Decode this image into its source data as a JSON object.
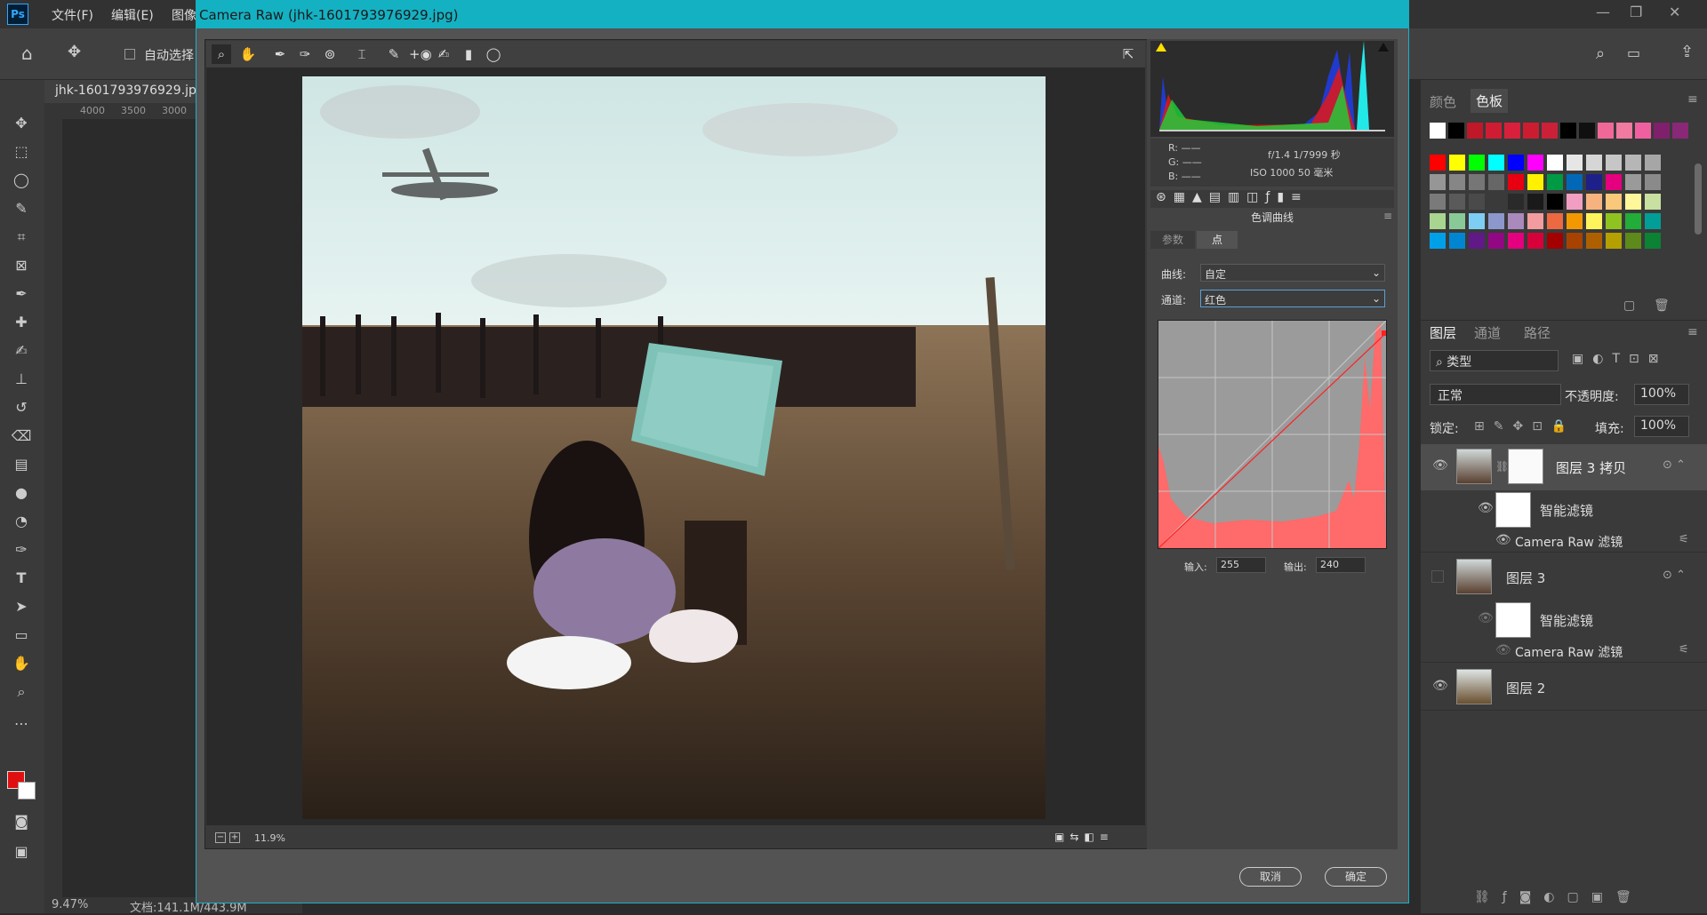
{
  "app": {
    "logo": "Ps",
    "menus": [
      "文件(F)",
      "编辑(E)",
      "图像"
    ]
  },
  "options_bar": {
    "auto_select_label": "自动选择"
  },
  "document": {
    "tab_title": "jhk-1601793976929.jpg",
    "ruler_ticks": [
      "4000",
      "3500",
      "3000"
    ],
    "zoom": "9.47%",
    "doc_info": "文档:141.1M/443.9M"
  },
  "dialog": {
    "title": "Camera Raw (jhk-1601793976929.jpg)",
    "preview_zoom": "11.9%",
    "cancel_label": "取消",
    "ok_label": "确定"
  },
  "camera_info": {
    "r": "R:  ——",
    "g": "G:  ——",
    "b": "B:  ——",
    "exposure": "f/1.4  1/7999 秒",
    "iso": "ISO 1000  50 毫米"
  },
  "curve_panel": {
    "section_title": "色调曲线",
    "tab_params": "参数",
    "tab_point": "点",
    "curve_label": "曲线:",
    "curve_value": "自定",
    "channel_label": "通道:",
    "channel_value": "红色",
    "input_label": "输入:",
    "input_value": "255",
    "output_label": "输出:",
    "output_value": "240"
  },
  "swatches_panel": {
    "tab_color": "颜色",
    "tab_swatches": "色板",
    "row1": [
      "#ffffff",
      "#000000",
      "#c01828",
      "#d01c32",
      "#d8203c",
      "#cc1c30",
      "#cc2038",
      "#000000",
      "#101010",
      "#f06898",
      "#f07aa0",
      "#f060a0",
      "#80206c",
      "#8a2878"
    ],
    "colors": [
      "#ff0000",
      "#ffff00",
      "#00ff00",
      "#00ffff",
      "#0000ff",
      "#ff00ff",
      "#ffffff",
      "#e6e6e6",
      "#d6d6d6",
      "#c6c6c6",
      "#b6b6b6",
      "#a6a6a6",
      "#969696",
      "#868686",
      "#767676",
      "#666666",
      "#e60012",
      "#fff100",
      "#009944",
      "#0068b7",
      "#1d2088",
      "#e4007f",
      "#9a9a9a",
      "#8a8a8a",
      "#7a7a7a",
      "#5a5a5a",
      "#4a4a4a",
      "#3a3a3a",
      "#2a2a2a",
      "#1a1a1a",
      "#000000",
      "#f19ec2",
      "#f6b37f",
      "#fac87a",
      "#fff799",
      "#c8e0a0",
      "#a8d590",
      "#89c997",
      "#7ecef4",
      "#8c97cb",
      "#aa89bd",
      "#f29c9f",
      "#ec6941",
      "#f39800",
      "#fff45c",
      "#8fc31f",
      "#22ac38",
      "#009e96",
      "#00a0e9",
      "#0086d1",
      "#601986",
      "#920783",
      "#e4007f",
      "#d7003a",
      "#a40000",
      "#a84200",
      "#ae6000",
      "#b4a000",
      "#5d8a1a",
      "#0b8234"
    ]
  },
  "layers_panel": {
    "tab_layers": "图层",
    "tab_channels": "通道",
    "tab_paths": "路径",
    "filter_kind": "类型",
    "blend_mode": "正常",
    "opacity_label": "不透明度:",
    "opacity_value": "100%",
    "lock_label": "锁定:",
    "fill_label": "填充:",
    "fill_value": "100%",
    "layers": [
      {
        "name": "图层 3 拷贝",
        "smart_filter": "智能滤镜",
        "filter_name": "Camera Raw 滤镜",
        "visible": true
      },
      {
        "name": "图层 3",
        "smart_filter": "智能滤镜",
        "filter_name": "Camera Raw 滤镜",
        "visible": false
      },
      {
        "name": "图层 2",
        "visible": true
      }
    ]
  },
  "colors": {
    "title_bar": "#14b1c3",
    "curve_red": "#ff3030",
    "fg_color": "#e01010"
  }
}
